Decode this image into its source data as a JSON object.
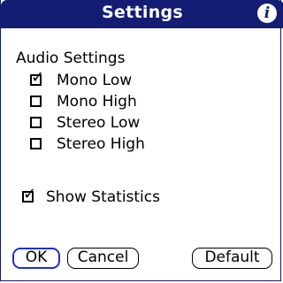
{
  "dialog": {
    "title": "Settings",
    "info_icon": "info-icon",
    "info_glyph": "i"
  },
  "audio": {
    "section_label": "Audio Settings",
    "options": [
      {
        "label": "Mono Low",
        "checked": true
      },
      {
        "label": "Mono High",
        "checked": false
      },
      {
        "label": "Stereo Low",
        "checked": false
      },
      {
        "label": "Stereo High",
        "checked": false
      }
    ]
  },
  "statistics": {
    "label": "Show Statistics",
    "checked": true
  },
  "buttons": {
    "ok": "OK",
    "cancel": "Cancel",
    "default": "Default"
  },
  "colors": {
    "titlebar": "#131d73",
    "focus_ring": "#2030c8"
  }
}
